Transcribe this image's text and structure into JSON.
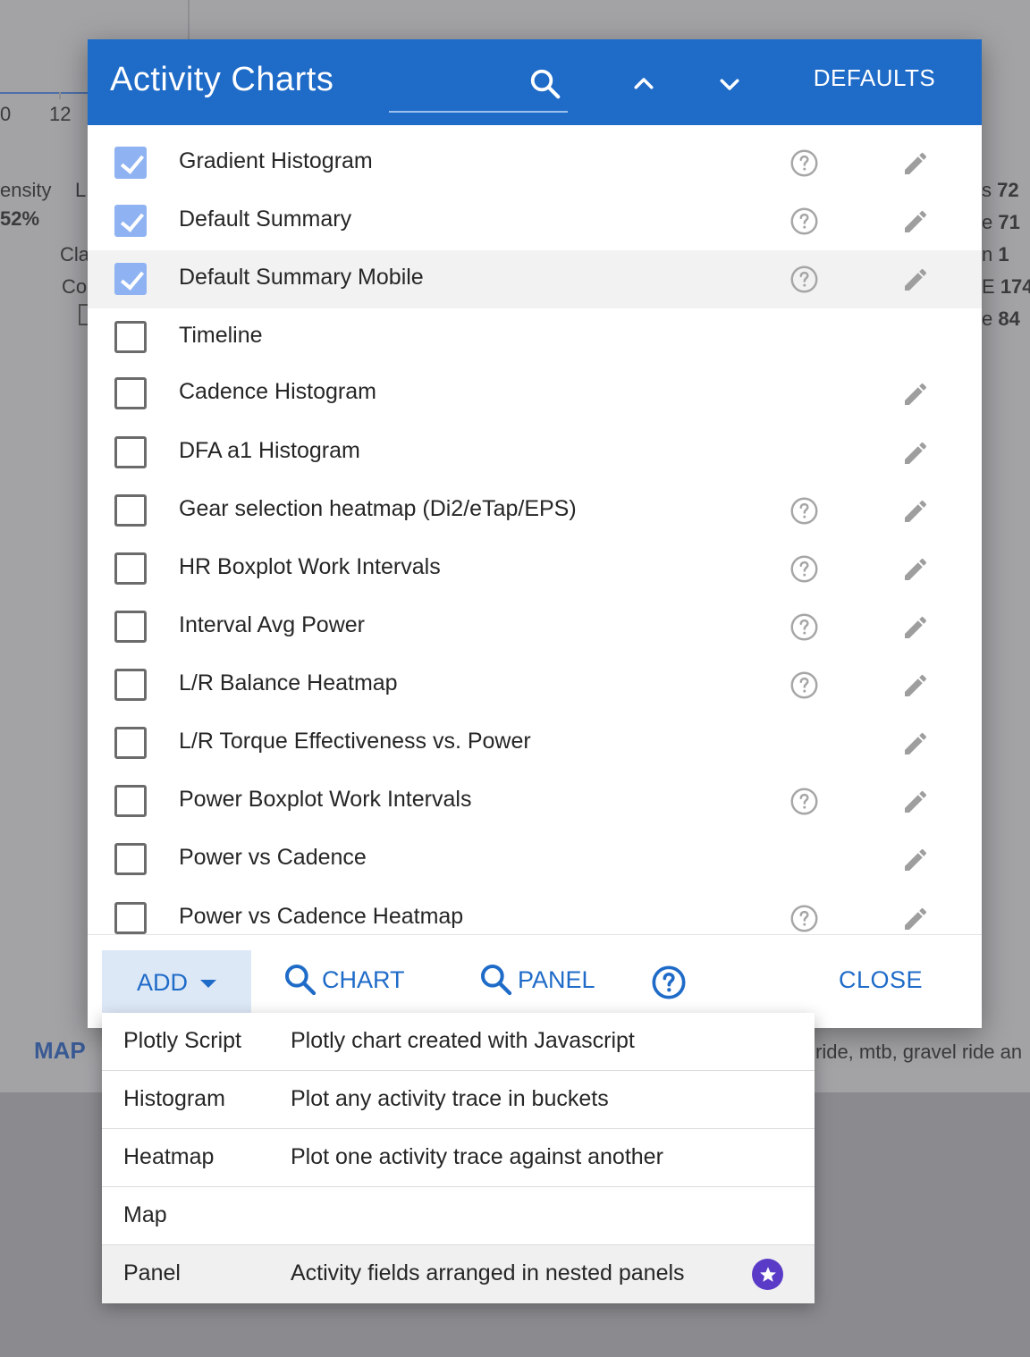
{
  "background": {
    "axis_tick_0": "0",
    "axis_tick_12": "12",
    "left_fragments": [
      "ensity",
      "L",
      "52%",
      "Cla",
      "Co"
    ],
    "right_fragments": [
      {
        "label": "s",
        "value": "72"
      },
      {
        "label": "e",
        "value": "71"
      },
      {
        "label": "n",
        "value": "1"
      },
      {
        "label": "E",
        "value": "174"
      },
      {
        "label": "e",
        "value": "84"
      }
    ],
    "map_label": "MAP",
    "description_fragment": "ride, mtb, gravel ride an"
  },
  "dialog": {
    "title": "Activity Charts",
    "search_placeholder": "",
    "defaults_label": "DEFAULTS",
    "icons": {
      "search": "search-icon",
      "move_up": "chevron-up-icon",
      "move_down": "chevron-down-icon",
      "help": "help-circle-icon",
      "edit": "pencil-icon"
    },
    "charts": [
      {
        "label": "Gradient Histogram",
        "checked": true,
        "help": true,
        "edit": true,
        "highlighted": false
      },
      {
        "label": "Default Summary",
        "checked": true,
        "help": true,
        "edit": true,
        "highlighted": false
      },
      {
        "label": "Default Summary Mobile",
        "checked": true,
        "help": true,
        "edit": true,
        "highlighted": true
      },
      {
        "label": "Timeline",
        "checked": false,
        "help": false,
        "edit": false,
        "highlighted": false
      },
      {
        "label": "Cadence Histogram",
        "checked": false,
        "help": false,
        "edit": true,
        "highlighted": false
      },
      {
        "label": "DFA a1 Histogram",
        "checked": false,
        "help": false,
        "edit": true,
        "highlighted": false
      },
      {
        "label": "Gear selection heatmap (Di2/eTap/EPS)",
        "checked": false,
        "help": true,
        "edit": true,
        "highlighted": false
      },
      {
        "label": "HR Boxplot Work Intervals",
        "checked": false,
        "help": true,
        "edit": true,
        "highlighted": false
      },
      {
        "label": "Interval Avg Power",
        "checked": false,
        "help": true,
        "edit": true,
        "highlighted": false
      },
      {
        "label": "L/R Balance Heatmap",
        "checked": false,
        "help": true,
        "edit": true,
        "highlighted": false
      },
      {
        "label": "L/R Torque Effectiveness vs. Power",
        "checked": false,
        "help": false,
        "edit": true,
        "highlighted": false
      },
      {
        "label": "Power Boxplot Work Intervals",
        "checked": false,
        "help": true,
        "edit": true,
        "highlighted": false
      },
      {
        "label": "Power vs Cadence",
        "checked": false,
        "help": false,
        "edit": true,
        "highlighted": false
      },
      {
        "label": "Power vs Cadence Heatmap",
        "checked": false,
        "help": true,
        "edit": true,
        "highlighted": false
      }
    ],
    "footer": {
      "add_label": "ADD",
      "chart_label": "CHART",
      "panel_label": "PANEL",
      "close_label": "CLOSE"
    }
  },
  "add_menu": [
    {
      "name": "Plotly Script",
      "description": "Plotly chart created with Javascript",
      "starred": false
    },
    {
      "name": "Histogram",
      "description": "Plot any activity trace in buckets",
      "starred": false
    },
    {
      "name": "Heatmap",
      "description": "Plot one activity trace against another",
      "starred": false
    },
    {
      "name": "Map",
      "description": "",
      "starred": false
    },
    {
      "name": "Panel",
      "description": "Activity fields arranged in nested panels",
      "starred": true
    }
  ],
  "colors": {
    "primary": "#1f6bc8",
    "checkbox_checked": "#8fb3f2",
    "star_badge": "#5a3bc7"
  }
}
